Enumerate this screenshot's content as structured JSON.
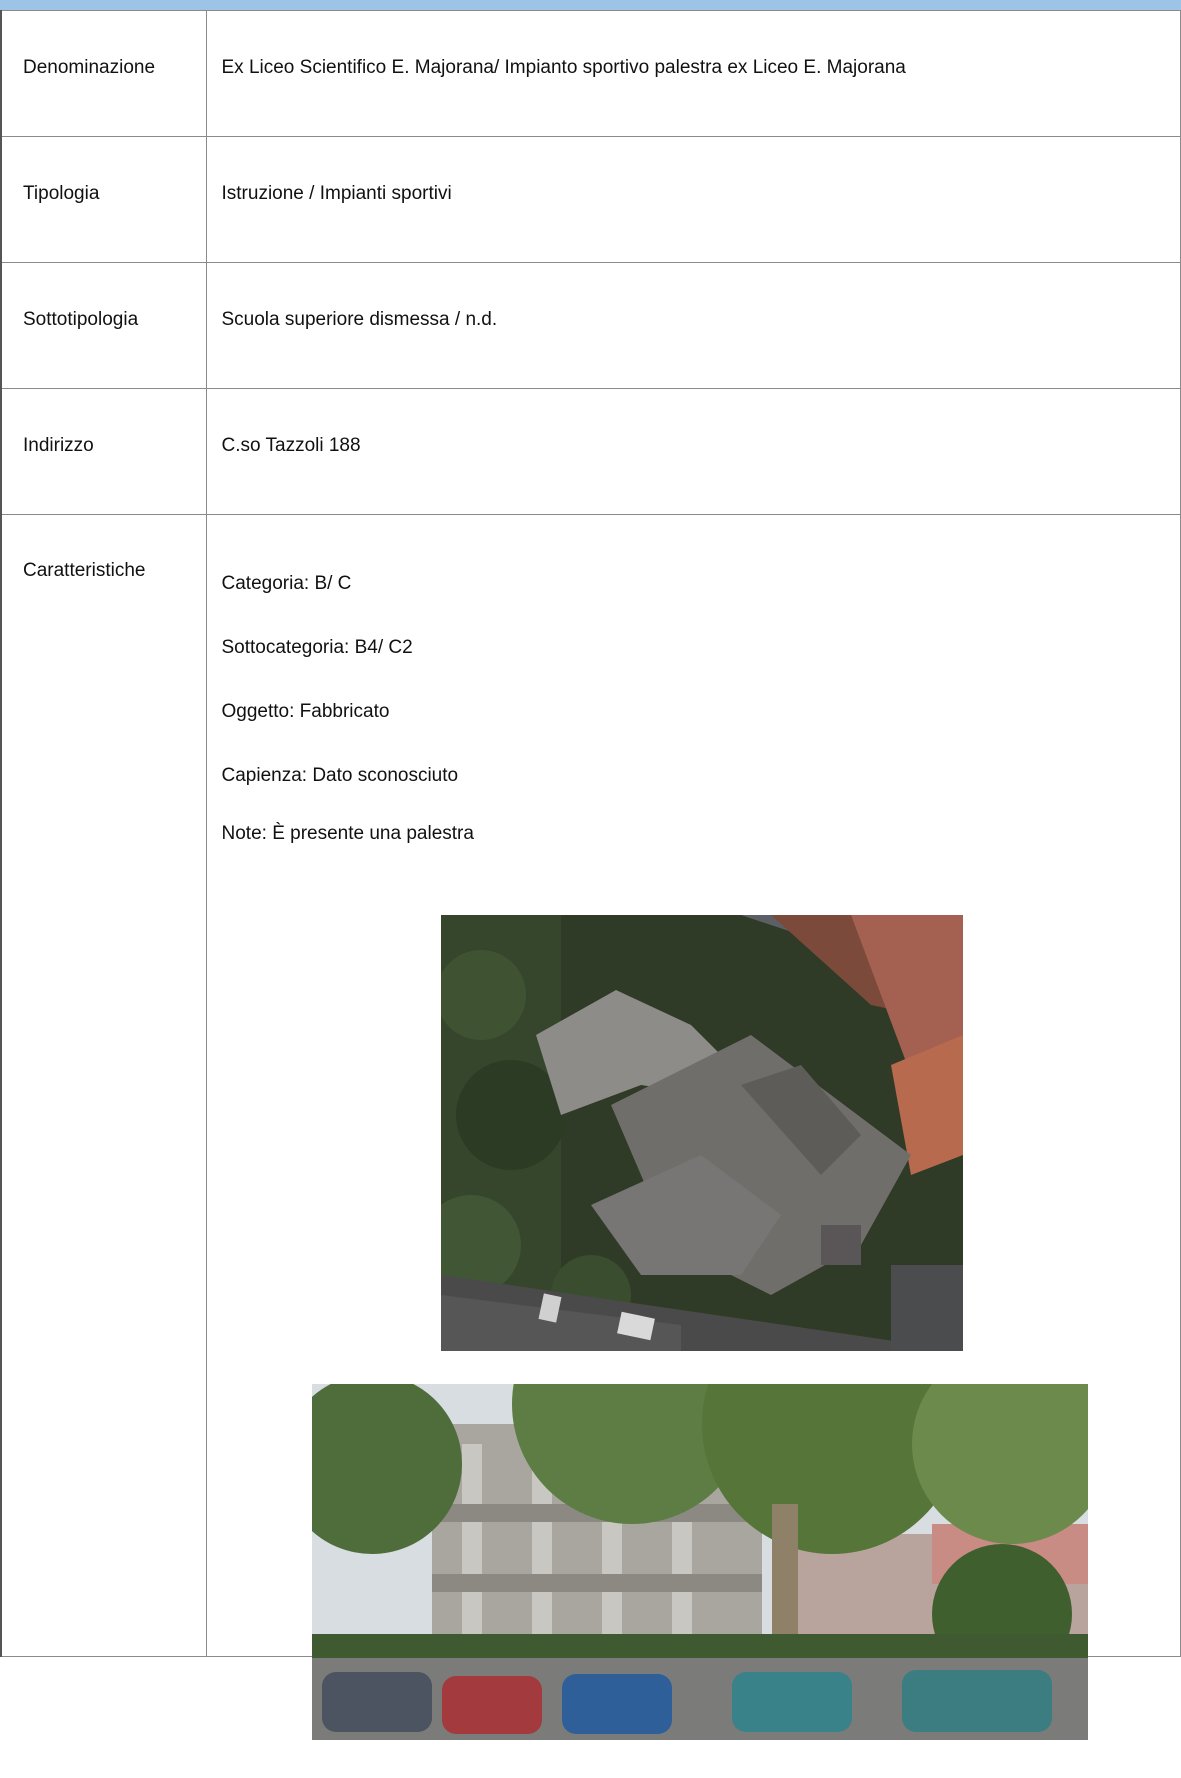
{
  "rows": [
    {
      "label": "Denominazione",
      "value": "Ex Liceo Scientifico E. Majorana/ Impianto sportivo palestra ex Liceo E. Majorana"
    },
    {
      "label": "Tipologia",
      "value": "Istruzione / Impianti sportivi"
    },
    {
      "label": "Sottotipologia",
      "value": "Scuola superiore dismessa / n.d."
    },
    {
      "label": "Indirizzo",
      "value": "C.so Tazzoli 188"
    }
  ],
  "caratteristiche": {
    "label": "Caratteristiche",
    "items": [
      "Categoria: B/ C",
      "Sottocategoria: B4/ C2",
      "Oggetto: Fabbricato",
      "Capienza: Dato sconosciuto",
      "Note: È presente una palestra"
    ]
  },
  "colors": {
    "header_band": "#9dc3e6",
    "border": "#8a8a8a"
  }
}
